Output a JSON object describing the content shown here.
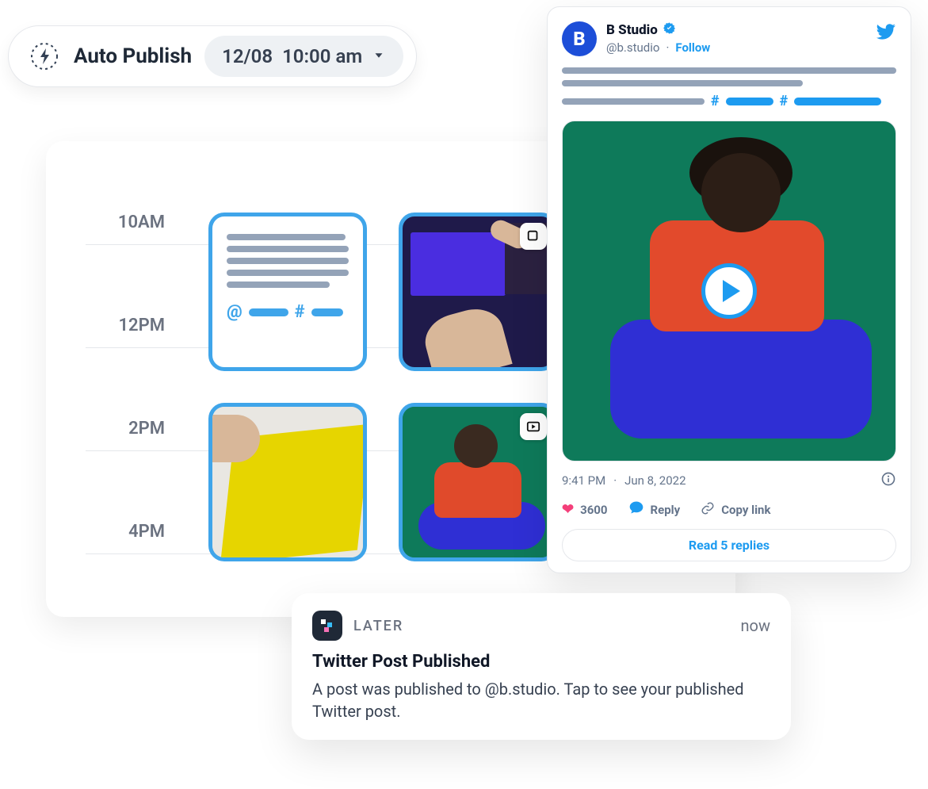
{
  "autopublish": {
    "label": "Auto Publish",
    "date": "12/08",
    "time": "10:00 am"
  },
  "calendar": {
    "times": [
      "10AM",
      "12PM",
      "2PM",
      "4PM"
    ]
  },
  "tweet": {
    "avatar_letter": "B",
    "name": "B Studio",
    "handle": "@b.studio",
    "follow": "Follow",
    "timestamp_time": "9:41 PM",
    "timestamp_date": "Jun 8, 2022",
    "likes": "3600",
    "reply_label": "Reply",
    "copy_label": "Copy link",
    "read_replies": "Read 5 replies"
  },
  "toast": {
    "app_name": "LATER",
    "time": "now",
    "title": "Twitter Post Published",
    "body": "A post was published to @b.studio. Tap to see your published Twitter post."
  }
}
